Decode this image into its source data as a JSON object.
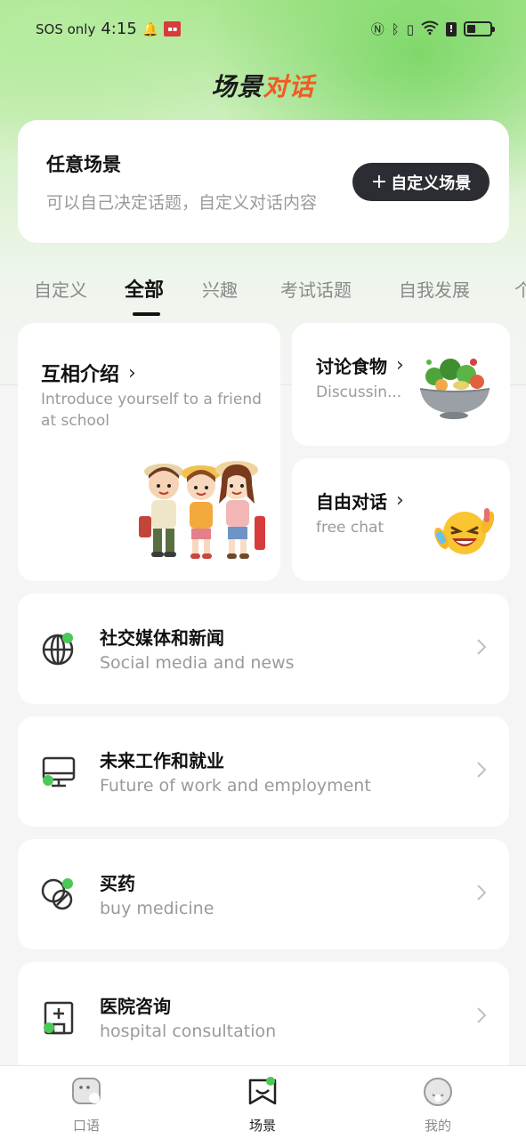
{
  "status_bar": {
    "carrier": "SOS only",
    "time": "4:15"
  },
  "header": {
    "title_part1": "场景",
    "title_part2": "对话"
  },
  "custom_scene": {
    "title": "任意场景",
    "description": "可以自己决定话题，自定义对话内容",
    "button_label": "自定义场景"
  },
  "tabs": [
    {
      "label": "自定义"
    },
    {
      "label": "全部"
    },
    {
      "label": "兴趣"
    },
    {
      "label": "考试话题"
    },
    {
      "label": "自我发展"
    },
    {
      "label": "个"
    }
  ],
  "active_tab": "全部",
  "featured": [
    {
      "title": "互相介绍",
      "subtitle": "Introduce yourself to a friend at school"
    },
    {
      "title": "讨论食物",
      "subtitle": "Discussin..."
    },
    {
      "title": "自由对话",
      "subtitle": "free chat"
    }
  ],
  "topics": [
    {
      "title": "社交媒体和新闻",
      "subtitle": "Social media and news",
      "icon": "globe-icon"
    },
    {
      "title": "未来工作和就业",
      "subtitle": "Future of work and employment",
      "icon": "monitor-icon"
    },
    {
      "title": "买药",
      "subtitle": "buy medicine",
      "icon": "pills-icon"
    },
    {
      "title": "医院咨询",
      "subtitle": "hospital consultation",
      "icon": "hospital-icon"
    }
  ],
  "bottom_nav": [
    {
      "label": "口语",
      "icon": "chat-face-icon"
    },
    {
      "label": "场景",
      "icon": "scene-icon"
    },
    {
      "label": "我的",
      "icon": "profile-icon"
    }
  ],
  "colors": {
    "accent_green": "#4cc85a",
    "title_orange": "#f15a24",
    "button_dark": "#2b2d33"
  }
}
